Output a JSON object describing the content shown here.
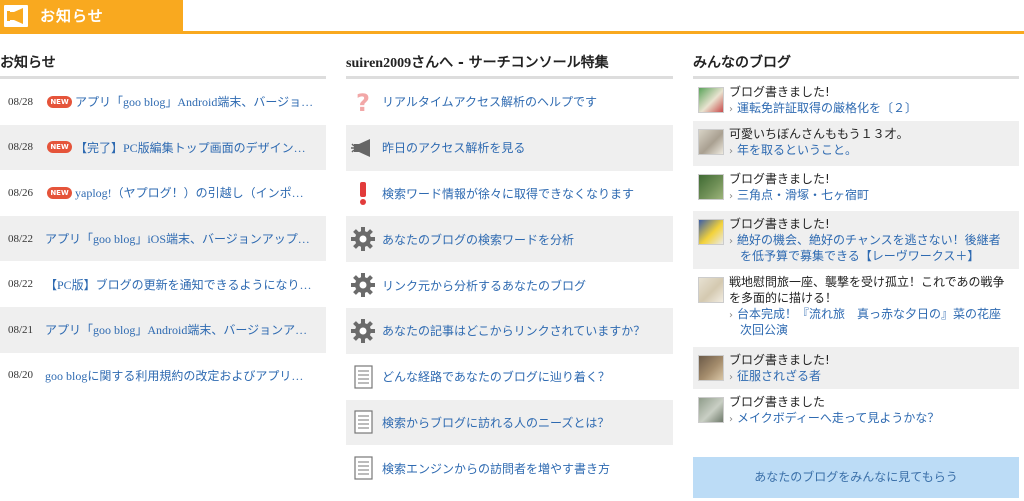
{
  "header": {
    "title": "お知らせ",
    "icon": "megaphone-icon",
    "accent_color": "#f9a91f"
  },
  "news": {
    "heading": "お知らせ",
    "badge": "NEW",
    "items": [
      {
        "date": "08/28",
        "is_new": true,
        "title": "アプリ「goo blog」Android端末、バージョ…"
      },
      {
        "date": "08/28",
        "is_new": true,
        "title": "【完了】PC版編集トップ画面のデザイン…"
      },
      {
        "date": "08/26",
        "is_new": true,
        "title": "yaplog!（ヤプログ！）の引越し（インポ…"
      },
      {
        "date": "08/22",
        "is_new": false,
        "title": "アプリ「goo blog」iOS端末、バージョンアップ…"
      },
      {
        "date": "08/22",
        "is_new": false,
        "title": "【PC版】ブログの更新を通知できるようになり…"
      },
      {
        "date": "08/21",
        "is_new": false,
        "title": "アプリ「goo blog」Android端末、バージョンア…"
      },
      {
        "date": "08/20",
        "is_new": false,
        "title": "goo blogに関する利用規約の改定およびアプリ…"
      }
    ]
  },
  "search_console": {
    "heading_user": "suiren2009",
    "heading_rest": "さんへ - サーチコンソール特集",
    "items": [
      {
        "icon": "question-icon",
        "label": "リアルタイムアクセス解析のヘルプです"
      },
      {
        "icon": "megaphone-icon",
        "label": "昨日のアクセス解析を見る"
      },
      {
        "icon": "exclamation-icon",
        "label": "検索ワード情報が徐々に取得できなくなります"
      },
      {
        "icon": "gear-icon",
        "label": "あなたのブログの検索ワードを分析"
      },
      {
        "icon": "gear-icon",
        "label": "リンク元から分析するあなたのブログ"
      },
      {
        "icon": "gear-icon",
        "label": "あなたの記事はどこからリンクされていますか？"
      },
      {
        "icon": "document-icon",
        "label": "どんな経路であなたのブログに辿り着く？"
      },
      {
        "icon": "document-icon",
        "label": "検索からブログに訪れる人のニーズとは？"
      },
      {
        "icon": "document-icon",
        "label": "検索エンジンからの訪問者を増やす書き方"
      }
    ]
  },
  "blogs": {
    "heading": "みんなのブログ",
    "items": [
      {
        "title": "ブログ書きました!",
        "links": [
          "運転免許証取得の厳格化を〔２〕"
        ]
      },
      {
        "title": "可愛いちぼんさんももう１３才。",
        "links": [
          "年を取るということ。"
        ]
      },
      {
        "title": "ブログ書きました!",
        "links": [
          "三角点・滑塚・七ヶ宿町"
        ]
      },
      {
        "title": "ブログ書きました!",
        "links": [
          "絶好の機会、絶好のチャンスを逃さない！後継者",
          "を低予算で募集できる【レーヴワークス＋】"
        ]
      },
      {
        "title": "戦地慰問旅一座、襲撃を受け孤立！これであの戦争",
        "title2": "を多面的に描ける！",
        "links": [
          "台本完成！『流れ旅　真っ赤な夕日の』菜の花座",
          "次回公演"
        ]
      },
      {
        "title": "ブログ書きました!",
        "links": [
          "征服されざる者"
        ]
      },
      {
        "title": "ブログ書きました",
        "links": [
          "メイクボディーへ走って見ようかな？"
        ]
      }
    ],
    "cta": "あなたのブログをみんなに見てもらう"
  }
}
